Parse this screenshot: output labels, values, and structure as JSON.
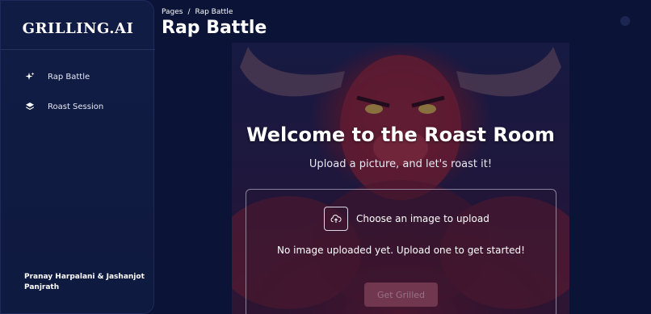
{
  "sidebar": {
    "logo": "GRILLING.AI",
    "items": [
      {
        "label": "Rap Battle",
        "icon": "sparkles-icon"
      },
      {
        "label": "Roast Session",
        "icon": "layers-icon"
      }
    ],
    "authors": "Pranay Harpalani & Jashanjot Panjrath"
  },
  "header": {
    "breadcrumb": [
      "Pages",
      "/",
      "Rap Battle"
    ],
    "title": "Rap Battle"
  },
  "main": {
    "welcome": "Welcome to the Roast Room",
    "subtitle": "Upload a picture, and let's roast it!",
    "upload_label": "Choose an image to upload",
    "upload_icon": "cloud-upload-icon",
    "status": "No image uploaded yet. Upload one to get started!",
    "button_label": "Get Grilled"
  },
  "colors": {
    "background": "#0b1437",
    "sidebar": "#111c44",
    "button": "#7a3d55"
  }
}
